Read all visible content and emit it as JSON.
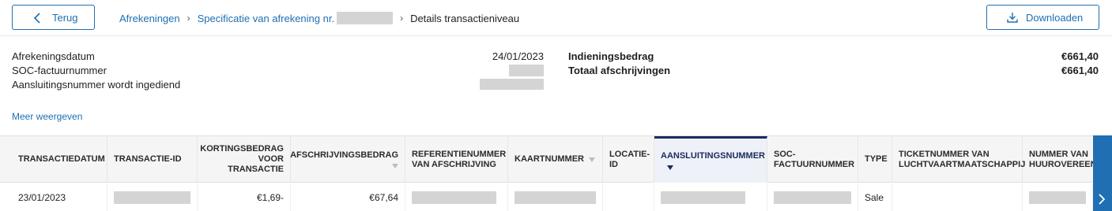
{
  "header": {
    "back_label": "Terug",
    "breadcrumb": {
      "item1": "Afrekeningen",
      "item2": "Specificatie van afrekening nr.",
      "current": "Details transactieniveau"
    },
    "download_label": "Downloaden"
  },
  "summary": {
    "left": [
      {
        "label": "Afrekeningsdatum",
        "value": "24/01/2023"
      },
      {
        "label": "SOC-factuurnummer",
        "value": ""
      },
      {
        "label": "Aansluitingsnummer wordt ingediend",
        "value": ""
      }
    ],
    "right": [
      {
        "label": "Indieningsbedrag",
        "value": "€661,40"
      },
      {
        "label": "Totaal afschrijvingen",
        "value": "€661,40"
      }
    ],
    "more_link": "Meer weergeven"
  },
  "table": {
    "headers": [
      "TRANSACTIEDATUM",
      "TRANSACTIE-ID",
      "KORTINGSBEDRAG VOOR TRANSACTIE",
      "AFSCHRIJVINGSBEDRAG",
      "REFERENTIENUMMER VAN AFSCHRIJVING",
      "KAARTNUMMER",
      "LOCATIE-ID",
      "AANSLUITINGSNUMMER",
      "SOC-FACTUURNUMMER",
      "TYPE",
      "TICKETNUMMER VAN LUCHTVAARTMAATSCHAPPIJ",
      "NUMMER VAN HUUROVEREENKOMST"
    ],
    "rows": [
      {
        "transactiedatum": "23/01/2023",
        "korting": "€1,69-",
        "afschrijving": "€67,64",
        "type": "Sale"
      }
    ]
  },
  "colors": {
    "accent": "#1f6fb2",
    "active_column": "#1a2b5f",
    "redaction": "#d4d4d4"
  }
}
